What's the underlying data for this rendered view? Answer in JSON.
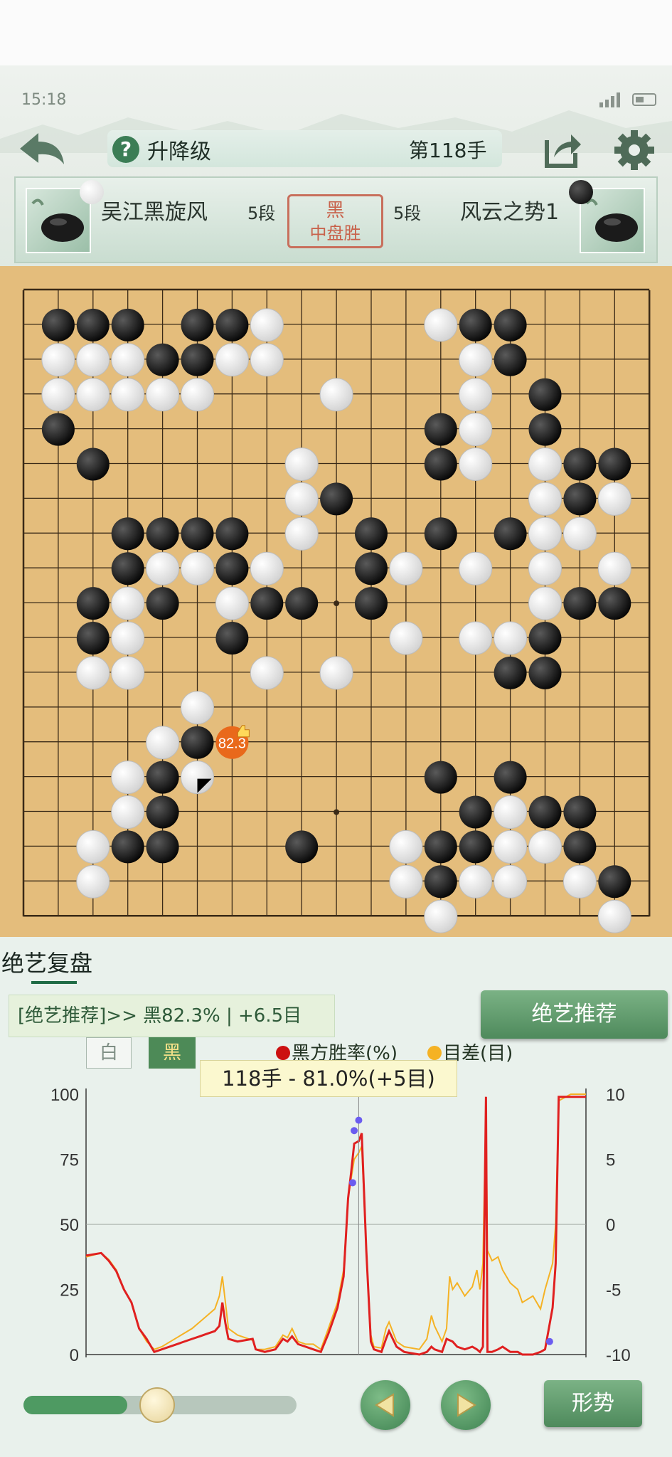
{
  "status_bar": {
    "time": "15:18"
  },
  "header": {
    "title": "升降级",
    "move_counter": "第118手"
  },
  "players": {
    "white": {
      "name": "吴江黑旋风",
      "rank": "5段"
    },
    "black": {
      "name": "风云之势1",
      "rank": "5段"
    },
    "result_line1": "黑",
    "result_line2": "中盘胜"
  },
  "board": {
    "size": 19,
    "black_stones": [
      [
        1,
        1
      ],
      [
        2,
        1
      ],
      [
        3,
        1
      ],
      [
        5,
        1
      ],
      [
        6,
        1
      ],
      [
        13,
        1
      ],
      [
        14,
        1
      ],
      [
        3,
        2
      ],
      [
        4,
        2
      ],
      [
        5,
        2
      ],
      [
        14,
        2
      ],
      [
        15,
        3
      ],
      [
        1,
        4
      ],
      [
        12,
        4
      ],
      [
        15,
        4
      ],
      [
        2,
        5
      ],
      [
        12,
        5
      ],
      [
        16,
        5
      ],
      [
        17,
        5
      ],
      [
        9,
        6
      ],
      [
        16,
        6
      ],
      [
        3,
        7
      ],
      [
        4,
        7
      ],
      [
        5,
        7
      ],
      [
        6,
        7
      ],
      [
        10,
        7
      ],
      [
        12,
        7
      ],
      [
        14,
        7
      ],
      [
        3,
        8
      ],
      [
        6,
        8
      ],
      [
        10,
        8
      ],
      [
        2,
        9
      ],
      [
        4,
        9
      ],
      [
        7,
        9
      ],
      [
        8,
        9
      ],
      [
        10,
        9
      ],
      [
        16,
        9
      ],
      [
        17,
        9
      ],
      [
        2,
        10
      ],
      [
        6,
        10
      ],
      [
        15,
        10
      ],
      [
        14,
        11
      ],
      [
        15,
        11
      ],
      [
        5,
        13
      ],
      [
        4,
        14
      ],
      [
        12,
        14
      ],
      [
        14,
        14
      ],
      [
        4,
        15
      ],
      [
        13,
        15
      ],
      [
        15,
        15
      ],
      [
        16,
        15
      ],
      [
        3,
        16
      ],
      [
        4,
        16
      ],
      [
        8,
        16
      ],
      [
        12,
        16
      ],
      [
        13,
        16
      ],
      [
        16,
        16
      ],
      [
        12,
        17
      ],
      [
        17,
        17
      ]
    ],
    "white_stones": [
      [
        7,
        1
      ],
      [
        12,
        1
      ],
      [
        1,
        2
      ],
      [
        2,
        2
      ],
      [
        3,
        2
      ],
      [
        6,
        2
      ],
      [
        7,
        2
      ],
      [
        13,
        2
      ],
      [
        1,
        3
      ],
      [
        2,
        3
      ],
      [
        3,
        3
      ],
      [
        4,
        3
      ],
      [
        5,
        3
      ],
      [
        9,
        3
      ],
      [
        13,
        3
      ],
      [
        13,
        4
      ],
      [
        8,
        5
      ],
      [
        13,
        5
      ],
      [
        15,
        5
      ],
      [
        8,
        6
      ],
      [
        15,
        6
      ],
      [
        17,
        6
      ],
      [
        8,
        7
      ],
      [
        15,
        7
      ],
      [
        16,
        7
      ],
      [
        4,
        8
      ],
      [
        5,
        8
      ],
      [
        7,
        8
      ],
      [
        11,
        8
      ],
      [
        13,
        8
      ],
      [
        15,
        8
      ],
      [
        17,
        8
      ],
      [
        3,
        9
      ],
      [
        6,
        9
      ],
      [
        15,
        9
      ],
      [
        3,
        10
      ],
      [
        11,
        10
      ],
      [
        13,
        10
      ],
      [
        14,
        10
      ],
      [
        2,
        11
      ],
      [
        3,
        11
      ],
      [
        7,
        11
      ],
      [
        9,
        11
      ],
      [
        5,
        12
      ],
      [
        4,
        13
      ],
      [
        3,
        14
      ],
      [
        5,
        14
      ],
      [
        3,
        15
      ],
      [
        14,
        15
      ],
      [
        2,
        16
      ],
      [
        11,
        16
      ],
      [
        14,
        16
      ],
      [
        15,
        16
      ],
      [
        2,
        17
      ],
      [
        11,
        17
      ],
      [
        13,
        17
      ],
      [
        14,
        17
      ],
      [
        16,
        17
      ],
      [
        12,
        18
      ],
      [
        17,
        18
      ]
    ],
    "last_move": [
      5,
      14
    ],
    "hint": {
      "col": 6,
      "row": 13,
      "label": "82.3"
    }
  },
  "review": {
    "tab_label": "绝艺复盘",
    "recommendation_text": "[绝艺推荐]>> 黑82.3% | +6.5目",
    "recommend_button": "绝艺推荐",
    "toggle_white": "白",
    "toggle_black": "黑",
    "tooltip": "118手 - 81.0%(+5目)",
    "shape_button": "形势",
    "slider_progress": 0.38
  },
  "colors": {
    "winrate": "#e02020",
    "score": "#f5b224",
    "board": "#e4bd7c",
    "accent": "#4e8a5c"
  },
  "chart_data": {
    "type": "line",
    "legend": [
      {
        "name": "黑方胜率(%)",
        "color": "#cc1111"
      },
      {
        "name": "目差(目)",
        "color": "#f5b224"
      }
    ],
    "y_left": {
      "ticks": [
        "100",
        "75",
        "50",
        "25",
        "0"
      ],
      "range": [
        0,
        100
      ]
    },
    "y_right": {
      "ticks": [
        "10",
        "5",
        "0",
        "-5",
        "-10"
      ],
      "range": [
        -10,
        10
      ]
    },
    "x_range": [
      0,
      285
    ],
    "cursor_move": 118,
    "series": [
      {
        "name": "黑方胜率(%)",
        "points": [
          [
            0,
            38
          ],
          [
            10,
            39
          ],
          [
            15,
            36
          ],
          [
            20,
            32
          ],
          [
            25,
            25
          ],
          [
            30,
            20
          ],
          [
            35,
            10
          ],
          [
            40,
            6
          ],
          [
            45,
            1
          ],
          [
            50,
            2
          ],
          [
            60,
            4
          ],
          [
            70,
            6
          ],
          [
            75,
            7
          ],
          [
            80,
            8
          ],
          [
            85,
            9
          ],
          [
            88,
            11
          ],
          [
            90,
            20
          ],
          [
            92,
            12
          ],
          [
            94,
            6
          ],
          [
            100,
            5
          ],
          [
            110,
            6
          ],
          [
            112,
            2
          ],
          [
            118,
            1
          ],
          [
            125,
            2
          ],
          [
            130,
            6
          ],
          [
            133,
            5
          ],
          [
            136,
            7
          ],
          [
            140,
            4
          ],
          [
            145,
            3
          ],
          [
            150,
            2
          ],
          [
            155,
            1
          ],
          [
            160,
            8
          ],
          [
            166,
            18
          ],
          [
            170,
            30
          ],
          [
            173,
            60
          ],
          [
            175,
            70
          ],
          [
            177,
            81
          ],
          [
            180,
            82
          ],
          [
            182,
            85
          ],
          [
            185,
            40
          ],
          [
            188,
            5
          ],
          [
            190,
            2
          ],
          [
            195,
            1
          ],
          [
            198,
            6
          ],
          [
            200,
            9
          ],
          [
            205,
            3
          ],
          [
            210,
            1
          ],
          [
            220,
            0
          ],
          [
            225,
            1
          ],
          [
            228,
            3
          ],
          [
            230,
            2
          ],
          [
            235,
            1
          ],
          [
            238,
            6
          ],
          [
            242,
            5
          ],
          [
            245,
            3
          ],
          [
            250,
            2
          ],
          [
            255,
            3
          ],
          [
            258,
            2
          ],
          [
            260,
            1
          ],
          [
            262,
            3
          ],
          [
            264,
            99
          ],
          [
            265,
            1
          ],
          [
            268,
            1
          ],
          [
            272,
            2
          ],
          [
            275,
            3
          ],
          [
            280,
            1
          ],
          [
            285,
            1
          ],
          [
            288,
            0
          ],
          [
            295,
            0
          ],
          [
            300,
            1
          ],
          [
            303,
            2
          ],
          [
            308,
            18
          ],
          [
            310,
            35
          ],
          [
            312,
            99
          ],
          [
            320,
            99
          ],
          [
            330,
            99
          ]
        ]
      },
      {
        "name": "目差(目)",
        "points": [
          [
            0,
            -2.5
          ],
          [
            10,
            -2.2
          ],
          [
            15,
            -2.7
          ],
          [
            20,
            -3.5
          ],
          [
            25,
            -5
          ],
          [
            30,
            -6
          ],
          [
            35,
            -8
          ],
          [
            40,
            -9
          ],
          [
            45,
            -9.6
          ],
          [
            50,
            -9.4
          ],
          [
            60,
            -8.7
          ],
          [
            70,
            -8
          ],
          [
            75,
            -7.5
          ],
          [
            80,
            -7
          ],
          [
            85,
            -6.5
          ],
          [
            88,
            -5.5
          ],
          [
            90,
            -4
          ],
          [
            92,
            -6
          ],
          [
            94,
            -8
          ],
          [
            100,
            -8.5
          ],
          [
            110,
            -8.9
          ],
          [
            112,
            -9.6
          ],
          [
            118,
            -9.6
          ],
          [
            125,
            -9.4
          ],
          [
            130,
            -8.5
          ],
          [
            133,
            -8.7
          ],
          [
            136,
            -8
          ],
          [
            140,
            -9
          ],
          [
            145,
            -9.2
          ],
          [
            150,
            -9.2
          ],
          [
            155,
            -9.6
          ],
          [
            160,
            -8
          ],
          [
            166,
            -6
          ],
          [
            170,
            -3.5
          ],
          [
            173,
            2
          ],
          [
            175,
            3.5
          ],
          [
            177,
            5
          ],
          [
            180,
            5.5
          ],
          [
            182,
            6
          ],
          [
            185,
            -2
          ],
          [
            188,
            -8.5
          ],
          [
            190,
            -9.4
          ],
          [
            195,
            -9.5
          ],
          [
            198,
            -8
          ],
          [
            200,
            -7.5
          ],
          [
            205,
            -9
          ],
          [
            210,
            -9.4
          ],
          [
            220,
            -9.6
          ],
          [
            225,
            -8.8
          ],
          [
            228,
            -7
          ],
          [
            230,
            -7.8
          ],
          [
            235,
            -9
          ],
          [
            238,
            -8
          ],
          [
            240,
            -4
          ],
          [
            242,
            -5
          ],
          [
            245,
            -4.5
          ],
          [
            250,
            -5.5
          ],
          [
            255,
            -4.8
          ],
          [
            258,
            -3.5
          ],
          [
            260,
            -5
          ],
          [
            262,
            -3
          ],
          [
            264,
            9
          ],
          [
            265,
            -2
          ],
          [
            268,
            -2.8
          ],
          [
            272,
            -2.5
          ],
          [
            275,
            -3.5
          ],
          [
            280,
            -4.5
          ],
          [
            285,
            -5
          ],
          [
            288,
            -6
          ],
          [
            295,
            -5.5
          ],
          [
            300,
            -6.5
          ],
          [
            303,
            -5
          ],
          [
            308,
            -3
          ],
          [
            310,
            0
          ],
          [
            312,
            9.5
          ],
          [
            320,
            10
          ],
          [
            330,
            10
          ]
        ]
      }
    ],
    "markers": [
      [
        176,
        66
      ],
      [
        177,
        86
      ],
      [
        180,
        90
      ],
      [
        306,
        5
      ]
    ]
  }
}
